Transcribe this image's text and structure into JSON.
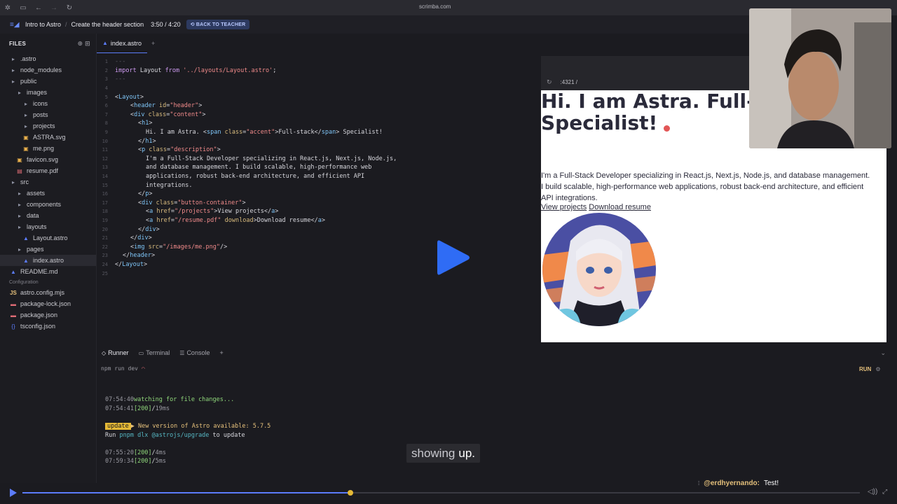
{
  "browser": {
    "url": "scrimba.com"
  },
  "topbar": {
    "course": "Intro to Astro",
    "lesson": "Create the header section",
    "time": "3:50 / 4:20",
    "back_button": "BACK TO TEACHER"
  },
  "sidebar": {
    "header": "FILES",
    "items": [
      {
        "label": ".astro",
        "kind": "folder",
        "depth": 0
      },
      {
        "label": "node_modules",
        "kind": "folder",
        "depth": 0
      },
      {
        "label": "public",
        "kind": "folder",
        "depth": 0
      },
      {
        "label": "images",
        "kind": "folder",
        "depth": 1
      },
      {
        "label": "icons",
        "kind": "folder",
        "depth": 2
      },
      {
        "label": "posts",
        "kind": "folder",
        "depth": 2
      },
      {
        "label": "projects",
        "kind": "folder",
        "depth": 2
      },
      {
        "label": "ASTRA.svg",
        "kind": "img",
        "depth": 2
      },
      {
        "label": "me.png",
        "kind": "img",
        "depth": 2
      },
      {
        "label": "favicon.svg",
        "kind": "img",
        "depth": 1
      },
      {
        "label": "resume.pdf",
        "kind": "pdf",
        "depth": 1
      },
      {
        "label": "src",
        "kind": "folder",
        "depth": 0
      },
      {
        "label": "assets",
        "kind": "folder",
        "depth": 1
      },
      {
        "label": "components",
        "kind": "folder",
        "depth": 1
      },
      {
        "label": "data",
        "kind": "folder",
        "depth": 1
      },
      {
        "label": "layouts",
        "kind": "folder",
        "depth": 1
      },
      {
        "label": "Layout.astro",
        "kind": "astro",
        "depth": 2
      },
      {
        "label": "pages",
        "kind": "folder",
        "depth": 1
      },
      {
        "label": "index.astro",
        "kind": "astro",
        "depth": 2,
        "active": true
      },
      {
        "label": "README.md",
        "kind": "md",
        "depth": 0
      }
    ],
    "config_label": "Configuration",
    "config_items": [
      {
        "label": "astro.config.mjs",
        "kind": "js"
      },
      {
        "label": "package-lock.json",
        "kind": "json"
      },
      {
        "label": "package.json",
        "kind": "json"
      },
      {
        "label": "tsconfig.json",
        "kind": "braces"
      }
    ]
  },
  "editor": {
    "tab": "index.astro",
    "lines": [
      {
        "n": "1",
        "indent": 0,
        "parts": [
          [
            "cm",
            "---"
          ]
        ]
      },
      {
        "n": "2",
        "indent": 0,
        "parts": [
          [
            "kw",
            "import "
          ],
          [
            "",
            "Layout "
          ],
          [
            "kw",
            "from "
          ],
          [
            "str",
            "'../layouts/Layout.astro'"
          ],
          [
            "",
            ";"
          ]
        ]
      },
      {
        "n": "3",
        "indent": 0,
        "parts": [
          [
            "cm",
            "---"
          ]
        ]
      },
      {
        "n": "4",
        "indent": 0,
        "parts": []
      },
      {
        "n": "5",
        "indent": 0,
        "parts": [
          [
            "",
            "<"
          ],
          [
            "tag",
            "Layout"
          ],
          [
            "",
            ">"
          ]
        ]
      },
      {
        "n": "6",
        "indent": 2,
        "parts": [
          [
            "",
            "<"
          ],
          [
            "tag",
            "header "
          ],
          [
            "attr",
            "id"
          ],
          [
            "",
            "="
          ],
          [
            "str",
            "\"header\""
          ],
          [
            "",
            ">"
          ]
        ]
      },
      {
        "n": "7",
        "indent": 2,
        "parts": [
          [
            "",
            "<"
          ],
          [
            "tag",
            "div "
          ],
          [
            "attr",
            "class"
          ],
          [
            "",
            "="
          ],
          [
            "str",
            "\"content\""
          ],
          [
            "",
            ">"
          ]
        ]
      },
      {
        "n": "8",
        "indent": 3,
        "parts": [
          [
            "",
            "<"
          ],
          [
            "tag",
            "h1"
          ],
          [
            "",
            ">"
          ]
        ]
      },
      {
        "n": "9",
        "indent": 4,
        "parts": [
          [
            "",
            "Hi. I am Astra. <"
          ],
          [
            "tag",
            "span "
          ],
          [
            "attr",
            "class"
          ],
          [
            "",
            "="
          ],
          [
            "str",
            "\"accent\""
          ],
          [
            "",
            ">Full-stack</"
          ],
          [
            "tag",
            "span"
          ],
          [
            "",
            "> Specialist!"
          ]
        ]
      },
      {
        "n": "10",
        "indent": 3,
        "parts": [
          [
            "",
            "</"
          ],
          [
            "tag",
            "h1"
          ],
          [
            "",
            ">"
          ]
        ]
      },
      {
        "n": "11",
        "indent": 3,
        "parts": [
          [
            "",
            "<"
          ],
          [
            "tag",
            "p "
          ],
          [
            "attr",
            "class"
          ],
          [
            "",
            "="
          ],
          [
            "str",
            "\"description\""
          ],
          [
            "",
            ">"
          ]
        ]
      },
      {
        "n": "12",
        "indent": 4,
        "parts": [
          [
            "",
            "I'm a Full-Stack Developer specializing in React.js, Next.js, Node.js,"
          ]
        ]
      },
      {
        "n": "13",
        "indent": 4,
        "parts": [
          [
            "",
            "and database management. I build scalable, high-performance web"
          ]
        ]
      },
      {
        "n": "14",
        "indent": 4,
        "parts": [
          [
            "",
            "applications, robust back-end architecture, and efficient API"
          ]
        ]
      },
      {
        "n": "15",
        "indent": 4,
        "parts": [
          [
            "",
            "integrations."
          ]
        ]
      },
      {
        "n": "16",
        "indent": 3,
        "parts": [
          [
            "",
            "</"
          ],
          [
            "tag",
            "p"
          ],
          [
            "",
            ">"
          ]
        ]
      },
      {
        "n": "17",
        "indent": 3,
        "parts": [
          [
            "",
            "<"
          ],
          [
            "tag",
            "div "
          ],
          [
            "attr",
            "class"
          ],
          [
            "",
            "="
          ],
          [
            "str",
            "\"button-container\""
          ],
          [
            "",
            ">"
          ]
        ]
      },
      {
        "n": "18",
        "indent": 4,
        "parts": [
          [
            "",
            "<"
          ],
          [
            "tag",
            "a "
          ],
          [
            "attr",
            "href"
          ],
          [
            "",
            "="
          ],
          [
            "str",
            "\"/projects\""
          ],
          [
            "",
            ">View projects</"
          ],
          [
            "tag",
            "a"
          ],
          [
            "",
            ">"
          ]
        ]
      },
      {
        "n": "19",
        "indent": 4,
        "parts": [
          [
            "",
            "<"
          ],
          [
            "tag",
            "a "
          ],
          [
            "attr",
            "href"
          ],
          [
            "",
            "="
          ],
          [
            "str",
            "\"/resume.pdf\""
          ],
          [
            "",
            " "
          ],
          [
            "attr",
            "download"
          ],
          [
            "",
            ">Download resume</"
          ],
          [
            "tag",
            "a"
          ],
          [
            "",
            ">"
          ]
        ]
      },
      {
        "n": "20",
        "indent": 3,
        "parts": [
          [
            "",
            "</"
          ],
          [
            "tag",
            "div"
          ],
          [
            "",
            ">"
          ]
        ]
      },
      {
        "n": "21",
        "indent": 2,
        "parts": [
          [
            "",
            "</"
          ],
          [
            "tag",
            "div"
          ],
          [
            "",
            ">"
          ]
        ]
      },
      {
        "n": "22",
        "indent": 2,
        "parts": [
          [
            "",
            "<"
          ],
          [
            "tag",
            "img "
          ],
          [
            "attr",
            "src"
          ],
          [
            "",
            "="
          ],
          [
            "str",
            "\"/images/me.png\""
          ],
          [
            "",
            "/>"
          ]
        ]
      },
      {
        "n": "23",
        "indent": 1,
        "parts": [
          [
            "",
            "</"
          ],
          [
            "tag",
            "header"
          ],
          [
            "",
            ">"
          ]
        ]
      },
      {
        "n": "24",
        "indent": 0,
        "parts": [
          [
            "",
            "</"
          ],
          [
            "tag",
            "Layout"
          ],
          [
            "",
            ">"
          ]
        ]
      },
      {
        "n": "25",
        "indent": 0,
        "parts": []
      }
    ]
  },
  "preview": {
    "address": ":4321 /",
    "heading_line1": "Hi. I am Astra. Full-stack",
    "heading_line2": "Specialist!",
    "description": "I'm a Full-Stack Developer specializing in React.js, Next.js, Node.js, and database management. I build scalable, high-performance web applications, robust back-end architecture, and efficient API integrations.",
    "link_projects": "View projects",
    "link_resume": "Download resume"
  },
  "panel": {
    "tabs": [
      "Runner",
      "Terminal",
      "Console"
    ],
    "command": "npm run dev",
    "run_label": "RUN",
    "log": [
      {
        "time": "07:54:40",
        "text": "watching for file changes..."
      },
      {
        "time": "07:54:41",
        "status": "[200]",
        "path": "/",
        "ms": "19ms"
      },
      {
        "badge": "update",
        "text": "▶ New version of Astro available: 5.7.5"
      },
      {
        "pre": "Run ",
        "cmd": "pnpm dlx @astrojs/upgrade",
        "post": " to update"
      },
      {
        "time": "07:55:20",
        "status": "[200]",
        "path": "/",
        "ms": "4ms"
      },
      {
        "time": "07:59:34",
        "status": "[200]",
        "path": "/",
        "ms": "5ms"
      }
    ]
  },
  "caption": {
    "dim": "showing",
    "bright": "up."
  },
  "comment": {
    "user": "@erdhyernando:",
    "text": "Test!"
  },
  "playback": {
    "progress": 0.392
  },
  "colors": {
    "accent": "#5c7cfa",
    "run": "#e5c07b",
    "handle": "#e5b936"
  }
}
